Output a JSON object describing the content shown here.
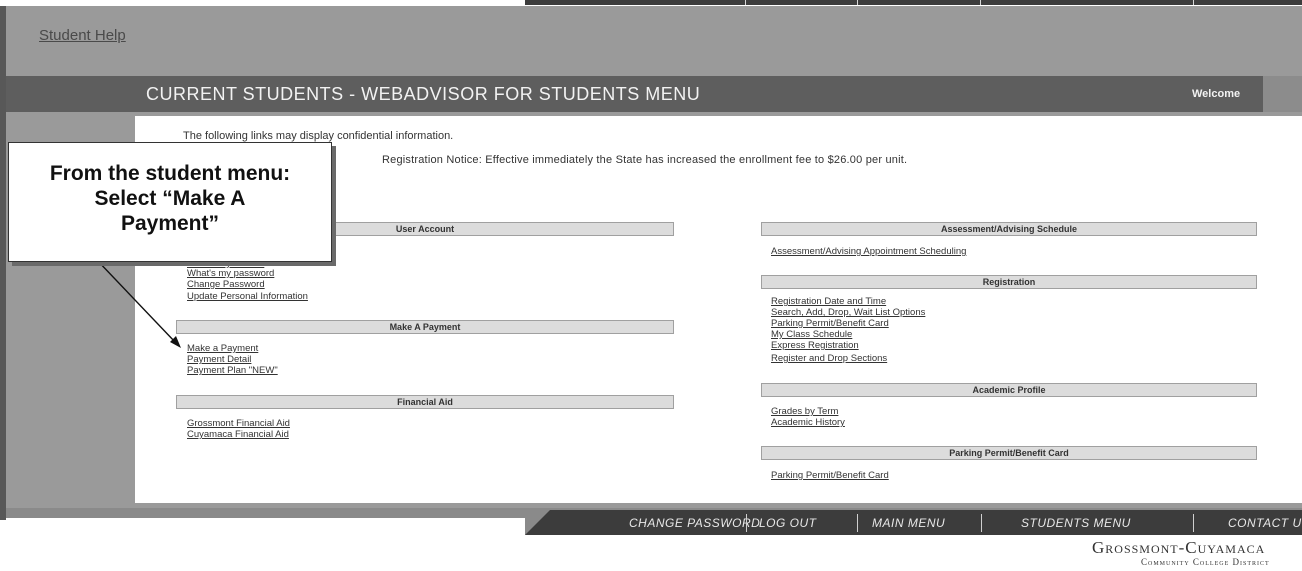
{
  "header": {
    "student_help": "Student Help"
  },
  "titlebar": {
    "title": "CURRENT STUDENTS - WEBADVISOR FOR STUDENTS MENU",
    "welcome": "Welcome"
  },
  "content": {
    "confidential": "The following links may display confidential information.",
    "notice": "Registration Notice: Effective immediately the State has increased the enrollment fee to $26.00 per unit."
  },
  "left_sections": [
    {
      "title": "User Account",
      "links": [
        "What's my user ID",
        "What's my password",
        "Change Password",
        "Update Personal Information"
      ]
    },
    {
      "title": "Make A Payment",
      "links": [
        "Make a Payment",
        "Payment Detail",
        "Payment Plan \"NEW\""
      ]
    },
    {
      "title": "Financial Aid",
      "links": [
        "Grossmont Financial Aid",
        "Cuyamaca Financial Aid"
      ]
    }
  ],
  "right_sections": [
    {
      "title": "Assessment/Advising Schedule",
      "links": [
        "Assessment/Advising Appointment Scheduling"
      ]
    },
    {
      "title": "Registration",
      "links": [
        "Registration Date and Time",
        "Search, Add, Drop, Wait List Options",
        "Parking Permit/Benefit Card",
        "My Class Schedule",
        "Express Registration",
        "Register and Drop Sections"
      ]
    },
    {
      "title": "Academic Profile",
      "links": [
        "Grades by Term",
        "Academic History"
      ]
    },
    {
      "title": "Parking Permit/Benefit Card",
      "links": [
        "Parking Permit/Benefit Card"
      ]
    }
  ],
  "callout": {
    "line1": "From the student menu:",
    "line2": "Select “Make A",
    "line3": "Payment”"
  },
  "nav": {
    "change_password": "CHANGE PASSWORD",
    "log_out": "LOG OUT",
    "main_menu": "MAIN MENU",
    "students_menu": "STUDENTS MENU",
    "contact": "CONTACT U"
  },
  "logo": {
    "line1": "Grossmont-Cuyamaca",
    "line2": "Community College District"
  }
}
